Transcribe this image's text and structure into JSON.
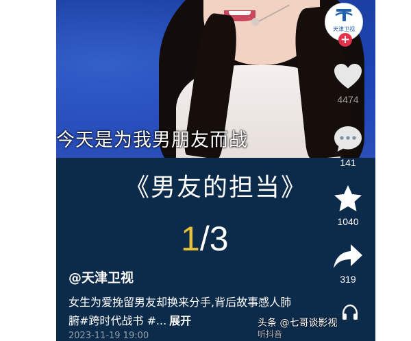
{
  "video": {
    "subtitle": "今天是为我男朋友而战"
  },
  "channel": {
    "logo_name": "天津卫视",
    "follow_label": "+"
  },
  "actions": {
    "like_count": "4474",
    "comment_count": "141",
    "favorite_count": "1040",
    "share_count": "319"
  },
  "panel": {
    "series_title": "《男友的担当》",
    "part_current": "1",
    "part_sep_total": "/3",
    "author": "@天津卫视",
    "description": "女生为爱挽留男友却换来分手,背后故事感人肺腑#跨时代战书 #...",
    "expand_label": "展开",
    "timestamp": "2023-11-19 19:00"
  },
  "watermark": {
    "text": "头条 @七哥谈影视",
    "sub": "听抖音"
  },
  "colors": {
    "panel_bg": "#0c2a49",
    "studio_blue": "#1d45b6",
    "part_highlight": "#e8c23a",
    "follow_red": "#e3304b"
  }
}
